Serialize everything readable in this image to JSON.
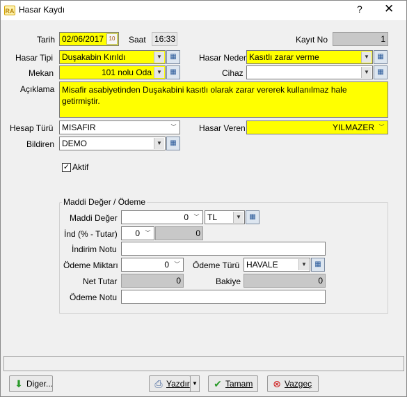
{
  "window": {
    "title": "Hasar Kaydı",
    "app_icon": "RA",
    "help": "?",
    "close": "✕"
  },
  "form": {
    "tarih_label": "Tarih",
    "tarih_value": "02/06/2017",
    "saat_label": "Saat",
    "saat_value": "16:33",
    "kayitno_label": "Kayıt No",
    "kayitno_value": "1",
    "hasartipi_label": "Hasar Tipi",
    "hasartipi_value": "Duşakabin Kırıldı",
    "hasarnedeni_label": "Hasar Nedeni",
    "hasarnedeni_value": "Kasıtlı zarar verme",
    "mekan_label": "Mekan",
    "mekan_value": "101 nolu Oda",
    "cihaz_label": "Cihaz",
    "cihaz_value": "",
    "aciklama_label": "Açıklama",
    "aciklama_value": "Misafir asabiyetinden Duşakabini kasıtlı olarak zarar vererek kullanılmaz hale getirmiştir.",
    "hesapturu_label": "Hesap Türü",
    "hesapturu_value": "MISAFIR",
    "hasarveren_label": "Hasar Veren",
    "hasarveren_value": "YILMAZER",
    "bildiren_label": "Bildiren",
    "bildiren_value": "DEMO",
    "aktif_label": "Aktif",
    "aktif_checked": true
  },
  "odeme": {
    "group_title": "Maddi Değer / Ödeme",
    "maddideger_label": "Maddi Değer",
    "maddideger_value": "0",
    "currency_value": "TL",
    "ind_label": "İnd (% - Tutar)",
    "ind_percent": "0",
    "ind_amount": "0",
    "indirimnotu_label": "İndirim Notu",
    "indirimnotu_value": "",
    "odememiktari_label": "Ödeme Miktarı",
    "odememiktari_value": "0",
    "odemeturu_label": "Ödeme Türü",
    "odemeturu_value": "HAVALE",
    "nettutar_label": "Net Tutar",
    "nettutar_value": "0",
    "bakiye_label": "Bakiye",
    "bakiye_value": "0",
    "odemenotu_label": "Ödeme Notu",
    "odemenotu_value": ""
  },
  "buttons": {
    "diger": "Diger...",
    "yazdir": "Yazdır",
    "tamam": "Tamam",
    "vazgec": "Vazgeç"
  },
  "colors": {
    "required_field": "#ffff00",
    "readonly_field": "#c8c8c8"
  }
}
